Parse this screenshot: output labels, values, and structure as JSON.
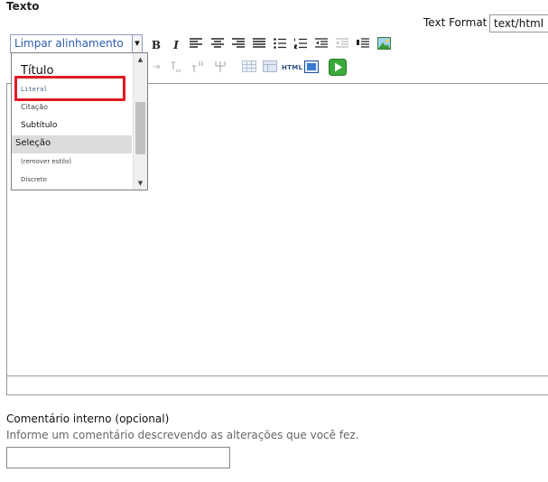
{
  "field": {
    "label": "Texto"
  },
  "text_format": {
    "label": "Text Format",
    "value": "text/html"
  },
  "style_select": {
    "value": "Limpar alinhamento"
  },
  "toolbar": {
    "bold": "B",
    "italic": "I",
    "html_label": "HTML"
  },
  "dropdown": {
    "items": [
      {
        "label": "Título"
      },
      {
        "label": "Literal"
      },
      {
        "label": "Citação"
      },
      {
        "label": "Subtítulo"
      },
      {
        "label": "Seleção"
      },
      {
        "label": "(remover estilo)"
      },
      {
        "label": "Discreto"
      }
    ]
  },
  "comment": {
    "label": "Comentário interno (opcional)",
    "help": "Informe um comentário descrevendo as alterações que você fez.",
    "value": ""
  },
  "colors": {
    "highlight": "#e01b24",
    "selected_bg": "#dcdcdc",
    "link_blue": "#2a5db0"
  }
}
